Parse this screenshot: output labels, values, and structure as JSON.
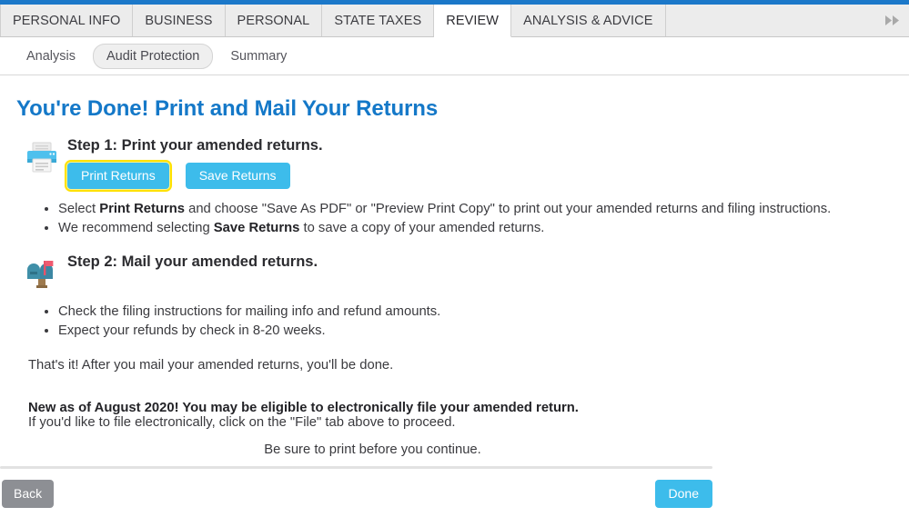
{
  "colors": {
    "top_rule": "#1b78c9",
    "heading": "#1478c8",
    "primary_button": "#3dbceb",
    "back_button": "#8d8f94",
    "focus_ring": "#ffe100",
    "tabstrip_bg": "#ececec",
    "pill_bg": "#efefef"
  },
  "tabs": [
    {
      "label": "PERSONAL INFO",
      "active": false
    },
    {
      "label": "BUSINESS",
      "active": false
    },
    {
      "label": "PERSONAL",
      "active": false
    },
    {
      "label": "STATE TAXES",
      "active": false
    },
    {
      "label": "REVIEW",
      "active": true
    },
    {
      "label": "ANALYSIS & ADVICE",
      "active": false
    }
  ],
  "tabstrip": {
    "scroll_more_icon": "double-chevron-right-icon",
    "scroll_more_glyph": "▶▶"
  },
  "subnav": [
    {
      "label": "Analysis",
      "selected": false
    },
    {
      "label": "Audit Protection",
      "selected": true
    },
    {
      "label": "Summary",
      "selected": false
    }
  ],
  "page": {
    "title": "You're Done! Print and Mail Your Returns"
  },
  "step1": {
    "icon": "printer-icon",
    "title": "Step 1: Print your amended returns.",
    "print_button": "Print Returns",
    "save_button": "Save Returns",
    "bullets": [
      {
        "parts": [
          {
            "text": "Select ",
            "bold": false
          },
          {
            "text": "Print Returns",
            "bold": true
          },
          {
            "text": " and choose \"Save As PDF\" or \"Preview Print Copy\" to print out your amended returns and filing instructions.",
            "bold": false
          }
        ]
      },
      {
        "parts": [
          {
            "text": "We recommend selecting ",
            "bold": false
          },
          {
            "text": "Save Returns",
            "bold": true
          },
          {
            "text": " to save a copy of your amended returns.",
            "bold": false
          }
        ]
      }
    ]
  },
  "step2": {
    "icon": "mailbox-icon",
    "title": "Step 2: Mail your amended returns.",
    "bullets": [
      {
        "parts": [
          {
            "text": "Check the filing instructions for mailing info and refund amounts.",
            "bold": false
          }
        ]
      },
      {
        "parts": [
          {
            "text": "Expect your refunds by check in 8-20 weeks.",
            "bold": false
          }
        ]
      }
    ]
  },
  "closing": {
    "line1": "That's it! After you mail your amended returns, you'll be done.",
    "line2_bold": "New as of August 2020! You may be eligible to electronically file your amended return.",
    "line3": "If you'd like to file electronically, click on the \"File\" tab above to proceed."
  },
  "footer": {
    "notice": "Be sure to print before you continue.",
    "back_label": "Back",
    "done_label": "Done"
  }
}
